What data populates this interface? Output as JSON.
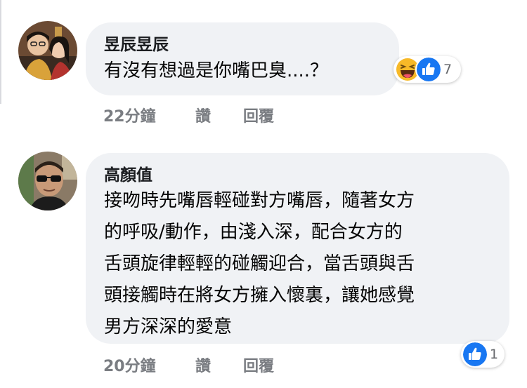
{
  "comments": [
    {
      "author": "昱辰昱辰",
      "lines": [
        "有沒有想過是你嘴巴臭....？"
      ],
      "time": "22分鐘",
      "like_label": "讚",
      "reply_label": "回覆",
      "reactions": {
        "icons": [
          "haha-icon",
          "like-icon"
        ],
        "count": "7"
      }
    },
    {
      "author": "高顏值",
      "lines": [
        "接吻時先嘴唇輕碰對方嘴唇，隨著女方",
        "的呼吸/動作，由淺入深，配合女方的",
        "舌頭旋律輕輕的碰觸迎合，當舌頭與舌",
        "頭接觸時在將女方擁入懷裏，讓她感覺",
        "男方深深的愛意"
      ],
      "time": "20分鐘",
      "like_label": "讚",
      "reply_label": "回覆",
      "reactions": {
        "icons": [
          "like-icon"
        ],
        "count": "1"
      }
    }
  ],
  "colors": {
    "bubble": "#f0f2f5",
    "meta_text": "#7a7d82",
    "like_blue": "#1877f2",
    "haha_yellow": "#f7b928"
  }
}
